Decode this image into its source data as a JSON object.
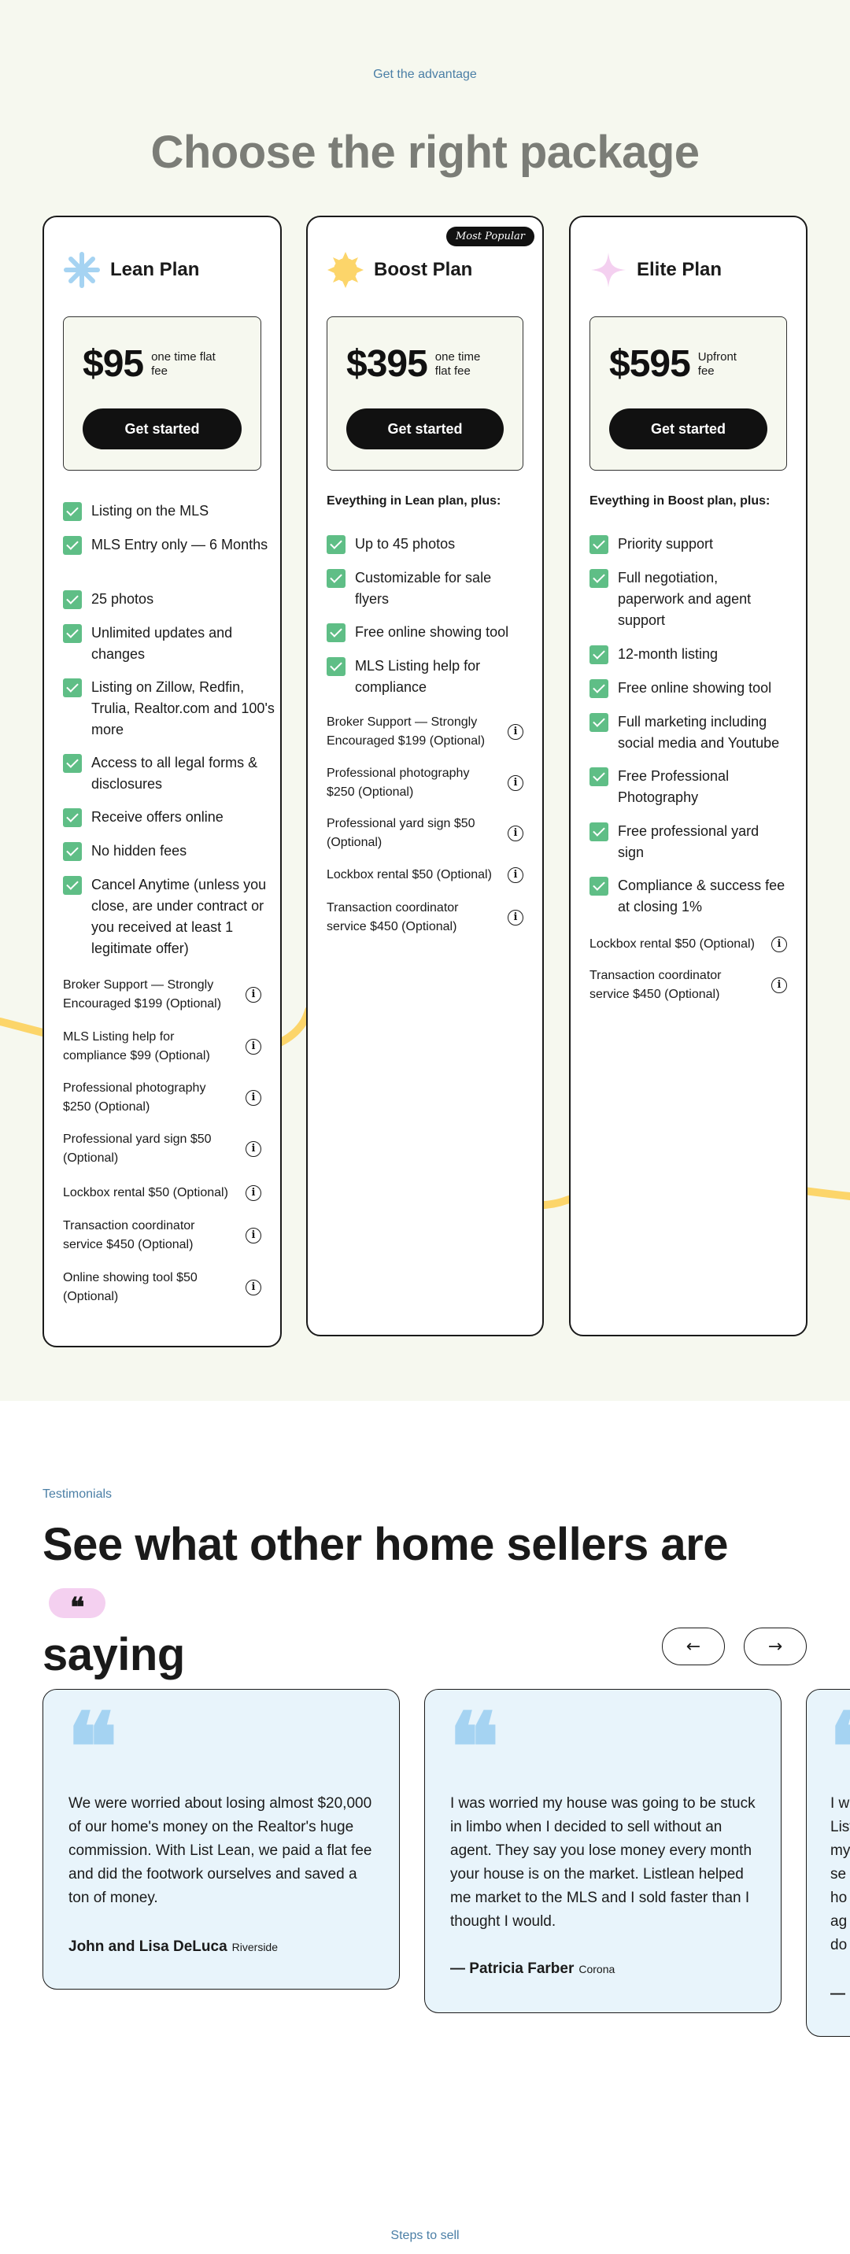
{
  "pricing": {
    "eyebrow": "Get the advantage",
    "title": "Choose the right package",
    "colors": {
      "background": "#f6f8ef",
      "check": "#5fbe86",
      "wave": "#fcd56a",
      "title": "#7b7d77"
    },
    "plans": [
      {
        "name": "Lean Plan",
        "icon": "asterisk-icon",
        "price": "$95",
        "price_note": "one time flat fee",
        "cta": "Get started",
        "features": [
          "Listing on the MLS",
          "MLS Entry only — 6 Months",
          "25 photos",
          "Unlimited updates and changes",
          "Listing on Zillow, Redfin, Trulia, Realtor.com and 100's more",
          "Access to all legal forms & disclosures",
          "Receive offers online",
          "No hidden fees",
          "Cancel Anytime (unless you close, are under contract or you received at least 1 legitimate offer)"
        ],
        "addons": [
          "Broker Support — Strongly Encouraged $199 (Optional)",
          "MLS Listing help for compliance $99 (Optional)",
          "Professional photography $250 (Optional)",
          "Professional yard sign $50 (Optional)",
          "Lockbox rental $50 (Optional)",
          "Transaction coordinator service $450 (Optional)",
          "Online showing tool $50 (Optional)"
        ]
      },
      {
        "name": "Boost Plan",
        "icon": "sun-icon",
        "badge": "Most Popular",
        "price": "$395",
        "price_note": "one time flat fee",
        "cta": "Get started",
        "features_lead": "Eveything in Lean plan, plus:",
        "features": [
          "Up to 45 photos",
          "Customizable for sale flyers",
          "Free online showing tool",
          "MLS Listing help for compliance"
        ],
        "addons": [
          "Broker Support — Strongly Encouraged $199 (Optional)",
          "Professional photography $250 (Optional)",
          "Professional yard sign $50 (Optional)",
          "Lockbox rental $50 (Optional)",
          "Transaction coordinator service $450 (Optional)"
        ]
      },
      {
        "name": "Elite Plan",
        "icon": "sparkle-icon",
        "price": "$595",
        "price_note": "Upfront fee",
        "cta": "Get started",
        "features_lead": "Eveything in Boost plan, plus:",
        "features": [
          "Priority support",
          "Full negotiation, paperwork and agent support",
          "12-month listing",
          "Free online showing tool",
          "Full marketing including social media and Youtube",
          "Free Professional Photography",
          "Free professional yard sign",
          "Compliance & success fee at closing 1%"
        ],
        "addons": [
          "Lockbox rental $50 (Optional)",
          "Transaction coordinator service $450 (Optional)"
        ]
      }
    ]
  },
  "testimonials": {
    "eyebrow": "Testimonials",
    "title": "See what other home sellers are",
    "title_line2": "saying",
    "pill_glyph": "❝",
    "prev_label": "←",
    "next_label": "→",
    "quote_mark": "❝",
    "colors": {
      "card": "#e8f4fb",
      "quote_mark": "#a5d3f2",
      "pill": "#f4d0f0"
    },
    "items": [
      {
        "text": "We were worried about losing almost $20,000 of our home's money on the Realtor's huge commission. With List Lean, we paid a flat fee and did the footwork ourselves and saved a ton of money.",
        "author": "John and Lisa DeLuca",
        "city": "Riverside"
      },
      {
        "text": "I was worried my house was going to be stuck in limbo when I decided to sell without an agent. They say you lose money every month your house is on the market. Listlean helped me market to the MLS and I sold faster than I thought I would.",
        "author": "— Patricia Farber",
        "city": "Corona"
      },
      {
        "text": "I w List my se ho ag do",
        "author": "—",
        "city": ""
      }
    ]
  },
  "steps": {
    "eyebrow": "Steps to sell"
  }
}
